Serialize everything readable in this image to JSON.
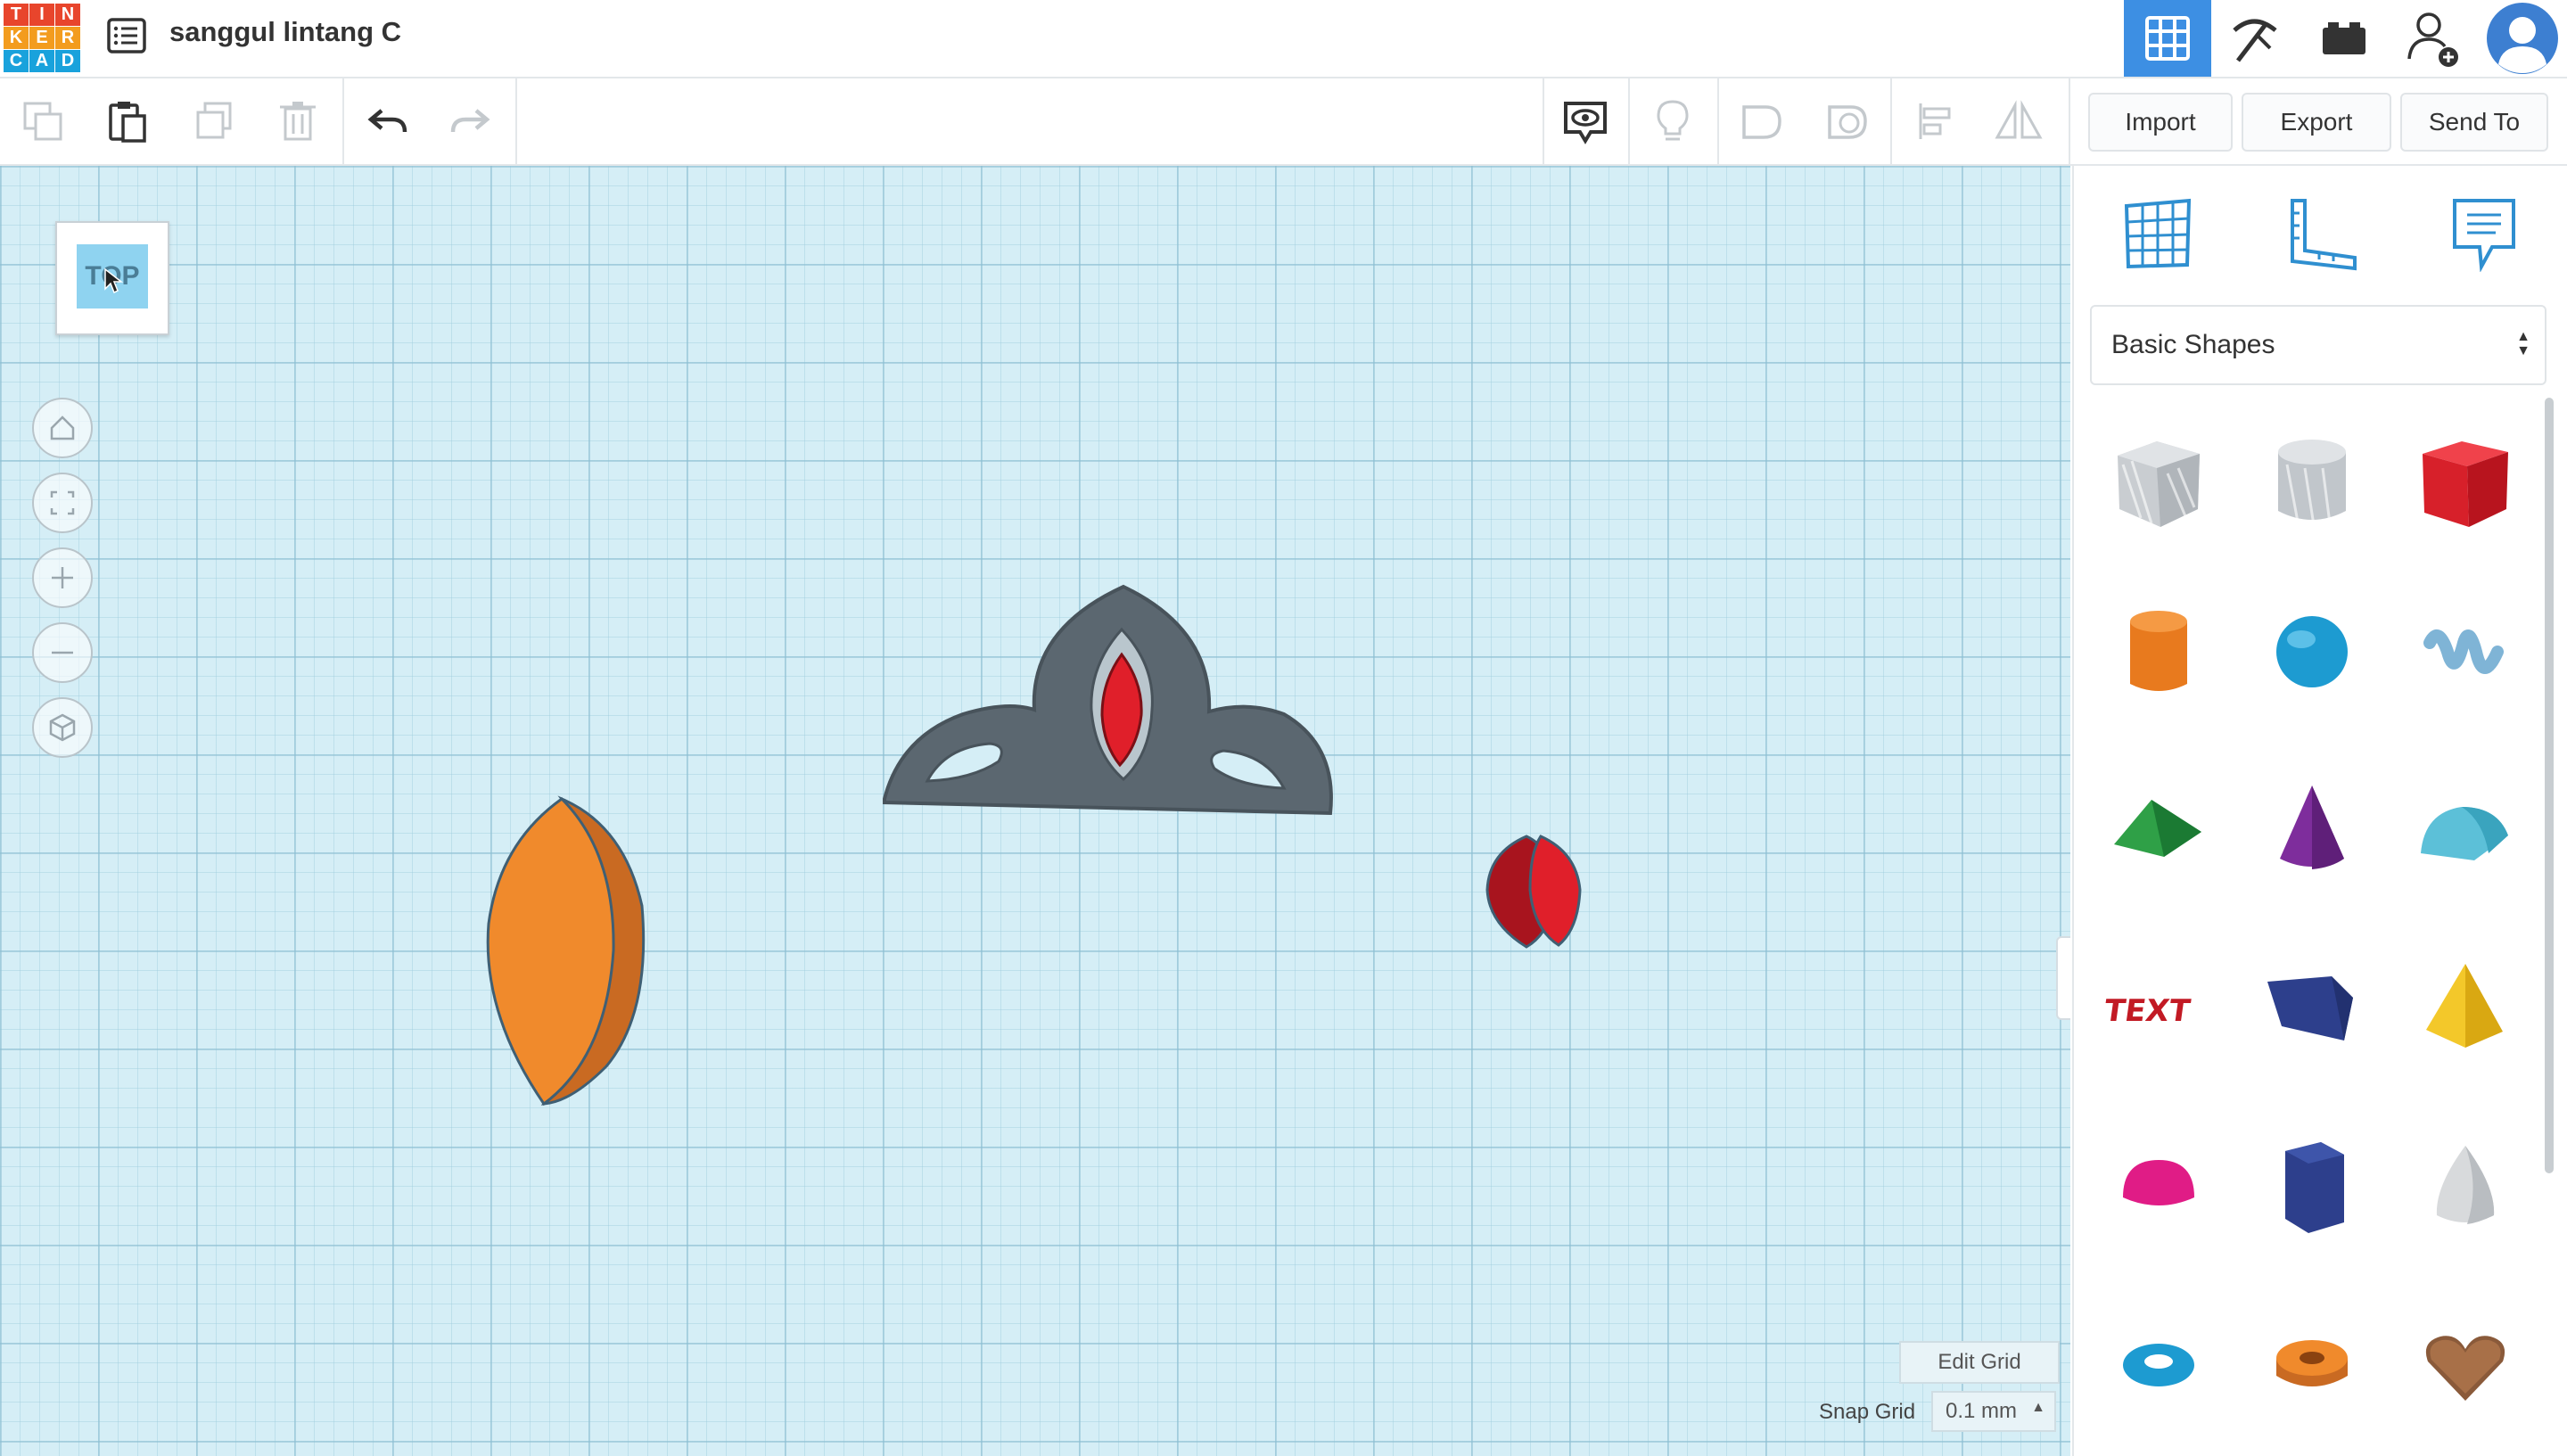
{
  "app": {
    "logo_letters": [
      "T",
      "I",
      "N",
      "K",
      "E",
      "R",
      "C",
      "A",
      "D"
    ],
    "logo_colors": [
      "#e8452c",
      "#e8452c",
      "#e8452c",
      "#f39c1e",
      "#f39c1e",
      "#f39c1e",
      "#19a2dc",
      "#19a2dc",
      "#19a2dc"
    ],
    "project_title": "sanggul lintang C"
  },
  "header": {
    "buttons": [
      {
        "name": "3d-design-view",
        "icon": "grid-icon",
        "active": true
      },
      {
        "name": "codeblocks-view",
        "icon": "pickaxe-icon",
        "active": false
      },
      {
        "name": "bricks-view",
        "icon": "brick-icon",
        "active": false
      },
      {
        "name": "invite-user",
        "icon": "add-user-icon",
        "active": false
      },
      {
        "name": "profile",
        "icon": "avatar-icon",
        "active": false
      }
    ]
  },
  "toolbar": {
    "left_tools": [
      "copy-icon",
      "paste-icon",
      "duplicate-icon",
      "delete-icon",
      "undo-icon",
      "redo-icon"
    ],
    "right_tools": [
      "show-hide-icon",
      "lightbulb-icon",
      "solid-shape-icon",
      "hole-shape-icon",
      "align-icon",
      "mirror-icon"
    ],
    "import_label": "Import",
    "export_label": "Export",
    "send_to_label": "Send To"
  },
  "workplane": {
    "viewcube_label": "TOP",
    "nav_tools": [
      "home-icon",
      "fit-view-icon",
      "zoom-in-icon",
      "zoom-out-icon",
      "perspective-icon"
    ],
    "edit_grid_label": "Edit Grid",
    "snap_grid_label": "Snap Grid",
    "snap_grid_value": "0.1 mm",
    "objects": [
      "tiara",
      "orange-leaf-shape",
      "red-gem-shape"
    ]
  },
  "panel": {
    "tabs": [
      "workplane-icon",
      "ruler-icon",
      "notes-icon"
    ],
    "category": "Basic Shapes",
    "shapes": [
      "Box hole",
      "Cylinder hole",
      "Box",
      "Cylinder",
      "Sphere",
      "Scribble",
      "Roof",
      "Cone",
      "Round Roof",
      "Text",
      "Wedge",
      "Pyramid",
      "Half Sphere",
      "Polygon",
      "Paraboloid",
      "Torus",
      "Tube",
      "Heart"
    ],
    "colors": {
      "accent": "#3d8fe3",
      "workplane": "#d5eef6",
      "orange": "#f08a2c",
      "red": "#e01f2a",
      "tiara": "#5b6770"
    }
  }
}
